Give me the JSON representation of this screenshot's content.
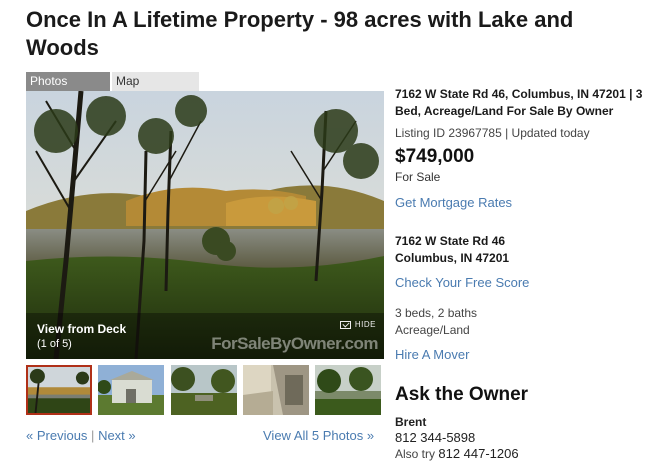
{
  "listing": {
    "title": "Once In A Lifetime Property - 98 acres with Lake and Woods",
    "tabs": [
      {
        "label": "Photos",
        "active": true
      },
      {
        "label": "Map",
        "active": false
      }
    ],
    "photo": {
      "caption": "View from Deck",
      "count": "(1 of 5)",
      "hide_label": "HIDE",
      "watermark": "ForSaleByOwner.com"
    },
    "pagination": {
      "previous": "« Previous",
      "separator": "|",
      "next": "Next »",
      "view_all": "View All 5 Photos »"
    },
    "details": {
      "headline": "7162 W State Rd 46, Columbus, IN 47201 | 3 Bed, Acreage/Land For Sale By Owner",
      "listing_id": "Listing ID 23967785 | Updated today",
      "price": "$749,000",
      "status": "For Sale",
      "mortgage_link": "Get Mortgage Rates",
      "address_line1": "7162 W State Rd 46",
      "address_line2": "Columbus, IN 47201",
      "score_link": "Check Your Free Score",
      "beds_baths": "3 beds, 2 baths",
      "property_type": "Acreage/Land",
      "mover_link": "Hire A Mover"
    },
    "owner": {
      "heading": "Ask the Owner",
      "name": "Brent",
      "phone": "812 344-5898",
      "also_try_label": "Also try",
      "alt_phone": "812 447-1206"
    }
  },
  "colors": {
    "link": "#4a7bb0",
    "active_tab": "#8a8a8a",
    "inactive_tab": "#e6e6e6",
    "selected_thumb_border": "#b03018"
  }
}
